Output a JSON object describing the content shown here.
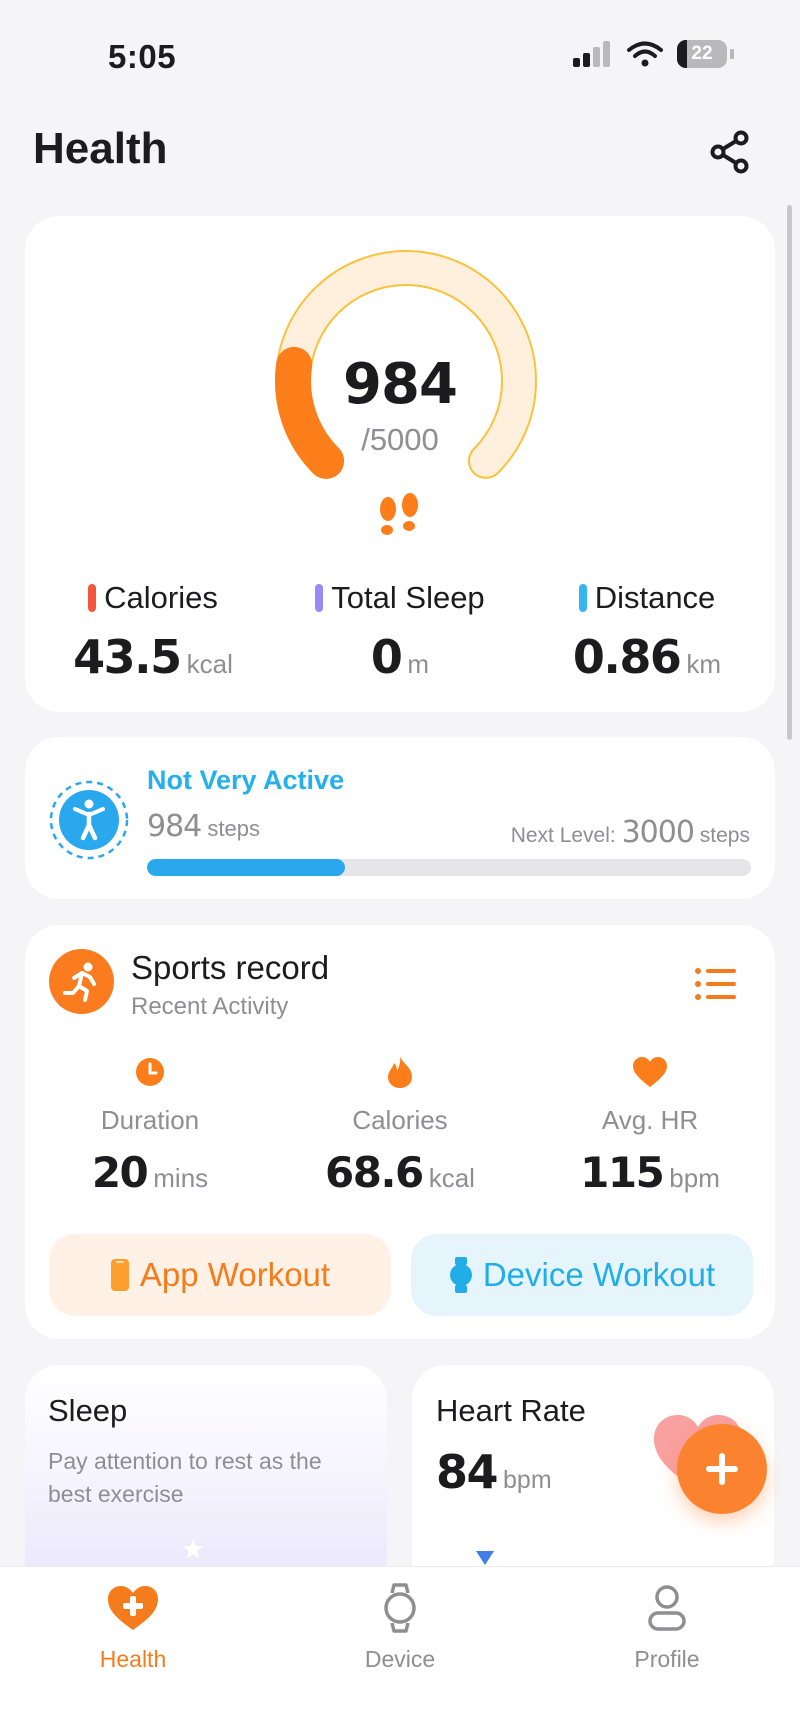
{
  "status_bar": {
    "time": "5:05",
    "battery": "22"
  },
  "header": {
    "title": "Health",
    "share_icon": "share-icon"
  },
  "steps": {
    "value": "984",
    "goal": "/5000",
    "progress_fraction": 0.197,
    "colors": {
      "track": "#fef0dd",
      "track_border": "#f9c23c",
      "fill": "#fb7e1a"
    }
  },
  "metrics": [
    {
      "label": "Calories",
      "value": "43.5",
      "unit": "kcal",
      "color": "#f4553d"
    },
    {
      "label": "Total Sleep",
      "value": "0",
      "unit": "m",
      "color": "#9b87f5"
    },
    {
      "label": "Distance",
      "value": "0.86",
      "unit": "km",
      "color": "#34b4f0"
    }
  ],
  "activity": {
    "level": "Not Very Active",
    "steps": "984",
    "steps_unit": "steps",
    "next_label": "Next Level:",
    "next_value": "3000",
    "next_unit": "steps",
    "progress_fraction": 0.328,
    "color": "#29a8ee"
  },
  "sports": {
    "title": "Sports record",
    "subtitle": "Recent Activity",
    "stats": [
      {
        "icon": "clock-icon",
        "label": "Duration",
        "value": "20",
        "unit": "mins"
      },
      {
        "icon": "flame-icon",
        "label": "Calories",
        "value": "68.6",
        "unit": "kcal"
      },
      {
        "icon": "heart-icon",
        "label": "Avg. HR",
        "value": "115",
        "unit": "bpm"
      }
    ],
    "app_workout": "App Workout",
    "device_workout": "Device Workout"
  },
  "sleep": {
    "title": "Sleep",
    "description": "Pay attention to rest as the best exercise"
  },
  "heart_rate": {
    "title": "Heart Rate",
    "value": "84",
    "unit": "bpm"
  },
  "tabs": [
    {
      "label": "Health",
      "icon": "heart-plus-icon",
      "active": true
    },
    {
      "label": "Device",
      "icon": "watch-icon",
      "active": false
    },
    {
      "label": "Profile",
      "icon": "person-icon",
      "active": false
    }
  ],
  "accent": "#f57c1d"
}
